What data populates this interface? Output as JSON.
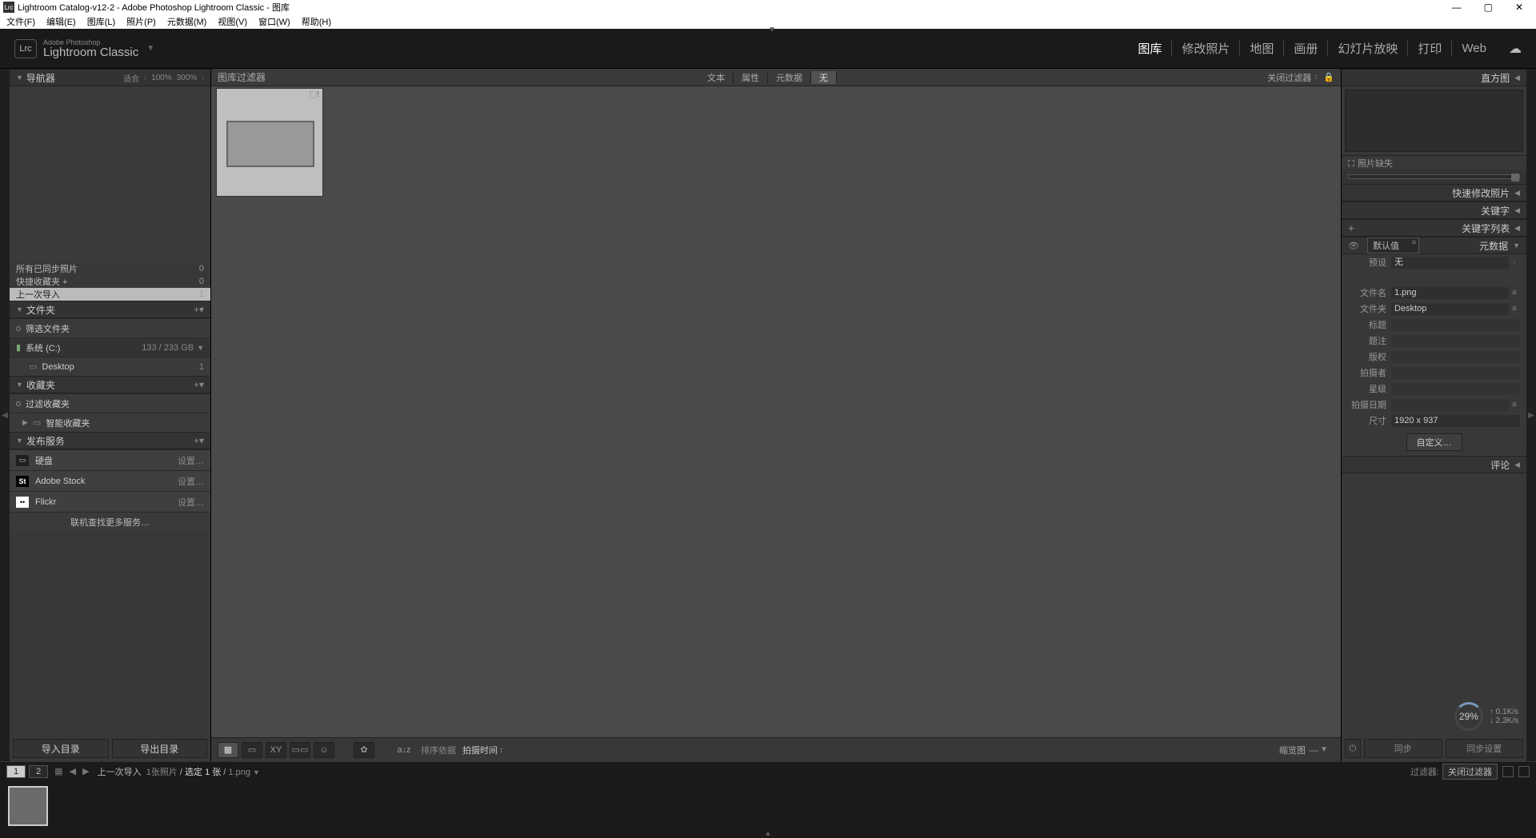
{
  "window": {
    "title": "Lightroom Catalog-v12-2 - Adobe Photoshop Lightroom Classic - 图库",
    "icon": "Lrc"
  },
  "menubar": [
    "文件(F)",
    "编辑(E)",
    "图库(L)",
    "照片(P)",
    "元数据(M)",
    "视图(V)",
    "窗口(W)",
    "帮助(H)"
  ],
  "brand": {
    "small": "Adobe Photoshop",
    "large": "Lightroom Classic"
  },
  "modules": [
    {
      "label": "图库",
      "active": true
    },
    {
      "label": "修改照片"
    },
    {
      "label": "地图"
    },
    {
      "label": "画册"
    },
    {
      "label": "幻灯片放映"
    },
    {
      "label": "打印"
    },
    {
      "label": "Web"
    }
  ],
  "left": {
    "navigator": {
      "label": "导航器",
      "fit": "适合",
      "p100": "100%",
      "p300": "300%"
    },
    "catalog": [
      {
        "label": "所有已同步照片",
        "count": "0"
      },
      {
        "label": "快捷收藏夹 +",
        "count": "0"
      },
      {
        "label": "上一次导入",
        "count": "1",
        "selected": true
      }
    ],
    "folders": {
      "label": "文件夹",
      "filter": "筛选文件夹",
      "volume": {
        "name": "系统 (C:)",
        "size": "133 / 233 GB"
      },
      "items": [
        {
          "name": "Desktop",
          "count": "1"
        }
      ]
    },
    "collections": {
      "label": "收藏夹",
      "filter": "过滤收藏夹",
      "smart": "智能收藏夹"
    },
    "publish": {
      "label": "发布服务",
      "setup": "设置…",
      "svcs": [
        {
          "name": "硬盘",
          "cls": "hd",
          "icn": "▭"
        },
        {
          "name": "Adobe Stock",
          "cls": "st",
          "icn": "St"
        },
        {
          "name": "Flickr",
          "cls": "fl",
          "icn": "••"
        }
      ],
      "more": "联机查找更多服务…"
    },
    "importBtn": "导入目录",
    "exportBtn": "导出目录"
  },
  "filterbar": {
    "label": "图库过滤器",
    "tabs": [
      {
        "label": "文本"
      },
      {
        "label": "属性"
      },
      {
        "label": "元数据"
      },
      {
        "label": "无",
        "active": true
      }
    ],
    "close": "关闭过滤器"
  },
  "toolbar": {
    "sortLabel": "排序依据",
    "sortValue": "拍摄时间",
    "thumbLabel": "缩览图"
  },
  "right": {
    "histogram": "直方图",
    "missing": "照片缺失",
    "panels": {
      "quick": "快速修改照片",
      "keyword": "关键字",
      "keywordlist": "关键字列表",
      "metadata": "元数据",
      "comments": "评论"
    },
    "metaDefault": "默认值",
    "preset": {
      "k": "预设",
      "v": "无"
    },
    "fields": [
      {
        "k": "文件名",
        "v": "1.png",
        "menu": true
      },
      {
        "k": "文件夹",
        "v": "Desktop",
        "menu": true
      },
      {
        "k": "标题",
        "v": ""
      },
      {
        "k": "题注",
        "v": ""
      },
      {
        "k": "版权",
        "v": ""
      },
      {
        "k": "拍摄者",
        "v": ""
      },
      {
        "k": "星级",
        "v": ""
      },
      {
        "k": "拍摄日期",
        "v": "",
        "menu": true
      },
      {
        "k": "尺寸",
        "v": "1920 x 937"
      }
    ],
    "customBtn": "自定义…",
    "sync": {
      "pct": "29%",
      "up": "0.1K/s",
      "down": "2.3K/s"
    },
    "syncBtn": "同步",
    "syncSettings": "同步设置"
  },
  "footer": {
    "views": [
      "1",
      "2"
    ],
    "crumb": {
      "path": "上一次导入",
      "count": "1张照片",
      "sel": "选定 1 张",
      "file": "1.png"
    },
    "filterLabel": "过滤器:",
    "filterValue": "关闭过滤器"
  }
}
